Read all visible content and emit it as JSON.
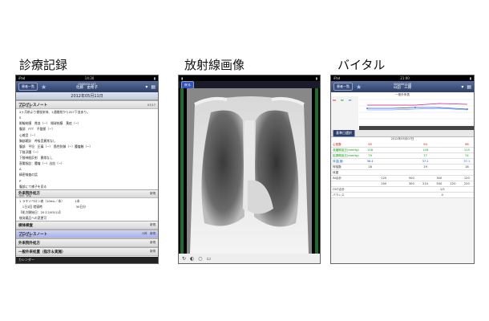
{
  "captions": {
    "records": "診療記録",
    "xray": "放射線画像",
    "vital": "バイタル"
  },
  "records_panel": {
    "status_left": "iPad",
    "status_time": "14:30",
    "nav_btn": "患者一覧",
    "patient_id": "0000001147",
    "patient_name": "佐藤　由希子",
    "date": "2012年05月11日",
    "progress_title": "プログレスノート",
    "progress_sub": "外科　外来",
    "progress_right": "07/17",
    "lines": [
      "2ヶ月前より便秘気味、1週間前から207下血あり。",
      "S",
      "眼瞼結膜　貧血（−）　眼球結膜　黄疸（−）",
      "腹部　FTT　不整脈（−）",
      "心雑音（−）",
      "胸部聴診　呼吸音異常なし",
      "腹部　平坦　圧痛（−）　筋性防御（−）腫瘤触（−）",
      "下肢浮腫（−）",
      "下肢神経反射　異常なし",
      "直腸指診：腫瘤（−）出血（−）",
      "A",
      "精密検査の話",
      "P",
      "腹部にて様子を見る"
    ],
    "sec_outpatient": "外来院外処方",
    "sec_outpatient_sub": "外科　外来",
    "sec_outpatient_right": "新規",
    "rx_lines": [
      "1 ラキソベロン液（10mL／本）　　　　1本",
      "　1日1回 就寝時　　　　　　　　　　　30日分",
      "【処方開始日：20１2/05/11】",
      "後発薬品への変更可"
    ],
    "sec_specimen": "検体検査",
    "sec_specimen_right": "新規",
    "sec_progress2": "プログレスノート",
    "sec_progress2_sub": "外科　外来",
    "sec_progress2_right": "小林　新規",
    "sec_outpatient2": "外来院外処方",
    "sec_outpatient2_right": "新規",
    "sec_general": "一般外来処置（指示＆実施）",
    "sec_general_right": "新規",
    "bottom": "カレンダー"
  },
  "xray_panel": {
    "toolbar_btn": "戻る"
  },
  "vital_panel": {
    "status_left": "iPad",
    "status_time": "21:00",
    "nav_btn": "患者一覧",
    "patient_id": "0000001148",
    "patient_name": "山田　三朗",
    "chart_title": "一般外来表",
    "tab": "基準日選択",
    "date_label": "2012年05月07日",
    "rows": [
      {
        "label": "心拍数",
        "values": [
          "95",
          "",
          "",
          "",
          "94",
          "",
          "",
          "96"
        ],
        "color": "#c00"
      },
      {
        "label": "収縮期血圧(mmHg)",
        "values": [
          "118",
          "",
          "",
          "",
          "116",
          "",
          "",
          "115"
        ],
        "color": "#090"
      },
      {
        "label": "拡張期血圧(mmHg)",
        "values": [
          "79",
          "",
          "",
          "",
          "77",
          "",
          "",
          "74"
        ],
        "color": "#090"
      },
      {
        "label": "体温(度)",
        "values": [
          "36.4",
          "",
          "",
          "",
          "37.2",
          "",
          "",
          "37.1"
        ],
        "color": "#06c"
      },
      {
        "label": "呼吸数",
        "values": [
          "18",
          "",
          "",
          "",
          "19",
          "",
          "",
          "18"
        ],
        "color": "#333"
      },
      {
        "label": "体重",
        "values": [
          "",
          "",
          "",
          "",
          "",
          "",
          "",
          ""
        ],
        "color": "#333"
      },
      {
        "label": "IN合計",
        "values": [
          "",
          "120",
          "",
          "500",
          "",
          "300",
          "",
          "120"
        ],
        "color": "#333"
      },
      {
        "label": "",
        "values": [
          "",
          "200",
          "",
          "300",
          "210",
          "500",
          "120",
          "220"
        ],
        "color": "#333"
      },
      {
        "label": "OUT合計",
        "values": [
          "",
          "",
          "",
          "",
          "",
          "",
          "1/5",
          "",
          ""
        ],
        "color": "#333"
      },
      {
        "label": "バランス",
        "values": [
          "",
          "",
          "",
          "",
          "",
          "",
          "0",
          "",
          ""
        ],
        "color": "#333"
      }
    ]
  }
}
